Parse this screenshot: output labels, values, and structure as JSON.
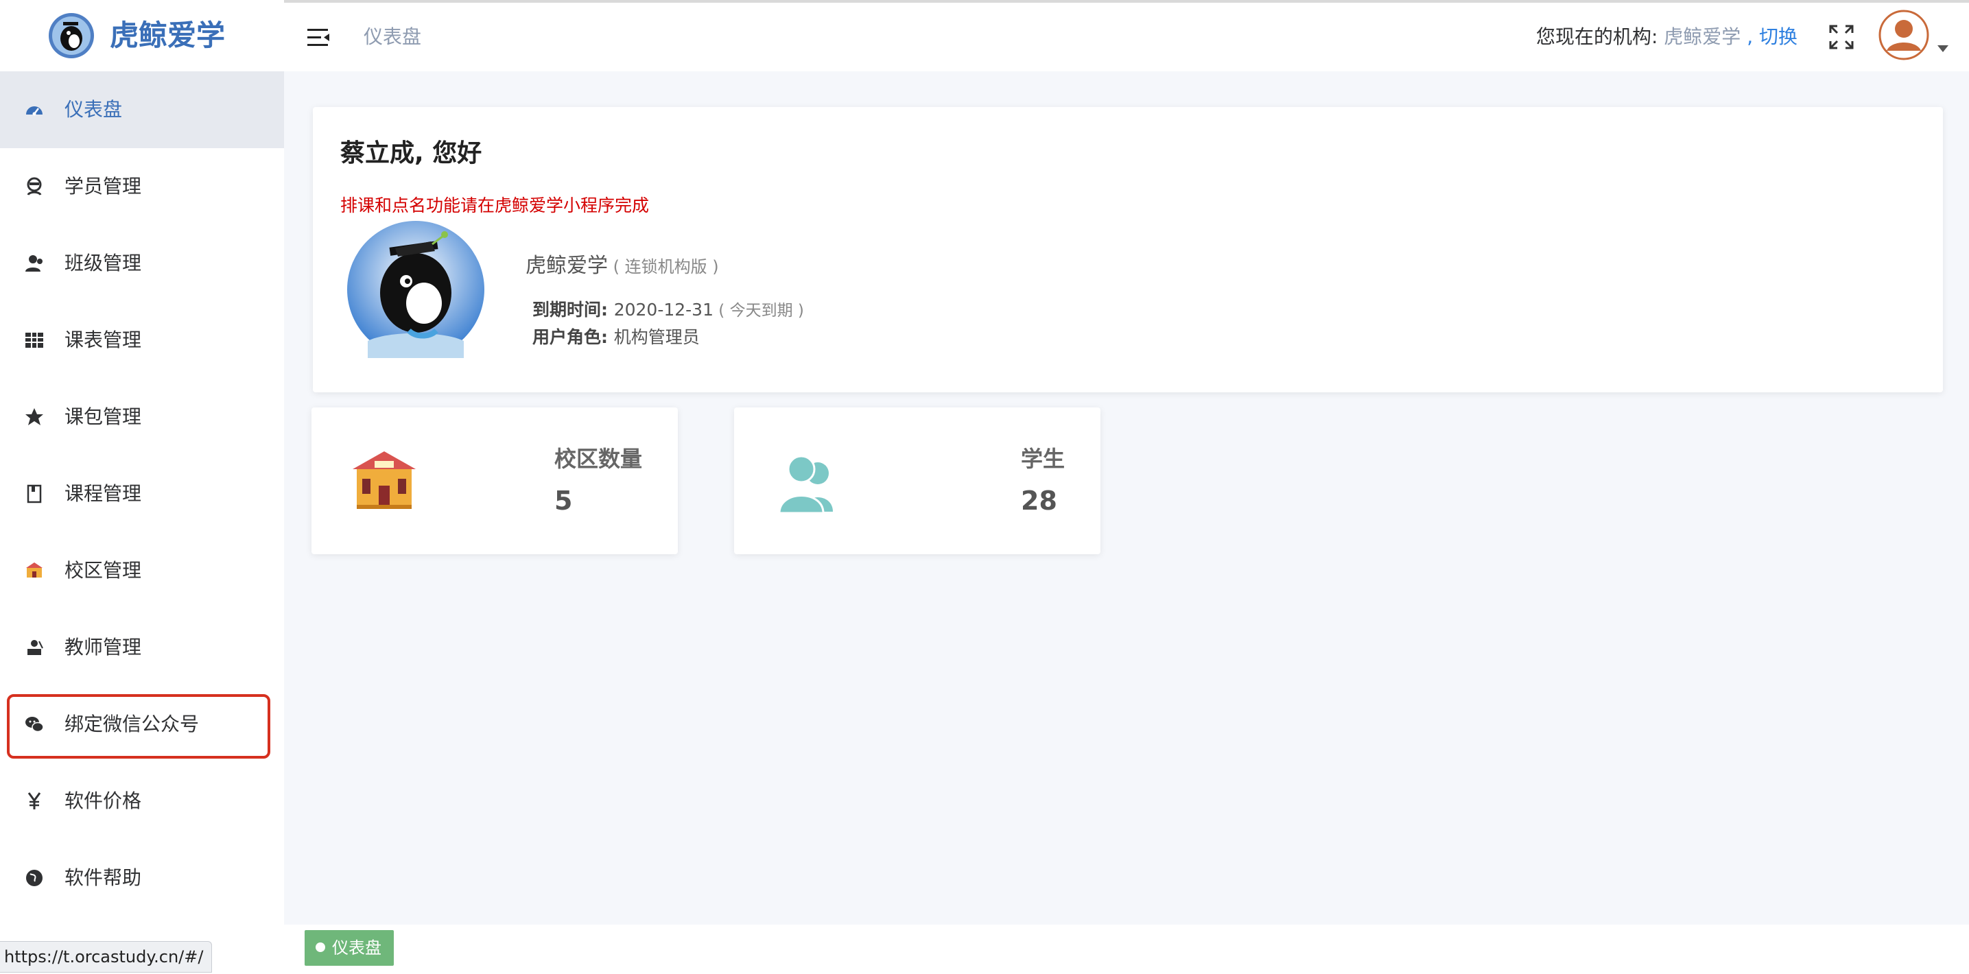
{
  "brand": {
    "title": "虎鲸爱学"
  },
  "sidebar": {
    "items": [
      {
        "label": "仪表盘",
        "icon": "dashboard-icon"
      },
      {
        "label": "学员管理",
        "icon": "student-icon"
      },
      {
        "label": "班级管理",
        "icon": "class-icon"
      },
      {
        "label": "课表管理",
        "icon": "schedule-icon"
      },
      {
        "label": "课包管理",
        "icon": "star-icon"
      },
      {
        "label": "课程管理",
        "icon": "book-icon"
      },
      {
        "label": "校区管理",
        "icon": "school-icon"
      },
      {
        "label": "教师管理",
        "icon": "teacher-icon"
      },
      {
        "label": "绑定微信公众号",
        "icon": "wechat-icon"
      },
      {
        "label": "软件价格",
        "icon": "yen-icon"
      },
      {
        "label": "软件帮助",
        "icon": "globe-icon"
      }
    ],
    "active_index": 0,
    "highlighted_index": 8
  },
  "header": {
    "breadcrumb": "仪表盘",
    "org_prefix": "您现在的机构: ",
    "org_name": "虎鲸爱学",
    "org_switch": " , 切换"
  },
  "welcome": {
    "greeting": "蔡立成, 您好",
    "notice": "排课和点名功能请在虎鲸爱学小程序完成",
    "org_title": "虎鲸爱学",
    "org_edition": " ( 连锁机构版 )",
    "expire_label": "到期时间: ",
    "expire_value": "2020-12-31",
    "expire_hint": " ( 今天到期 )",
    "role_label": "用户角色: ",
    "role_value": "机构管理员"
  },
  "stats": [
    {
      "label": "校区数量",
      "value": "5",
      "icon": "school-building-icon"
    },
    {
      "label": "学生",
      "value": "28",
      "icon": "students-group-icon"
    }
  ],
  "tags": [
    {
      "label": "仪表盘",
      "active": true
    }
  ],
  "status_url": "https://t.orcastudy.cn/#/",
  "colors": {
    "brand": "#3a6fb8",
    "active_bg": "#e6e9ef",
    "notice": "#d40000",
    "tag": "#6fb77a",
    "highlight_border": "#d6301f",
    "stat_icon": "#7cc8c6"
  }
}
